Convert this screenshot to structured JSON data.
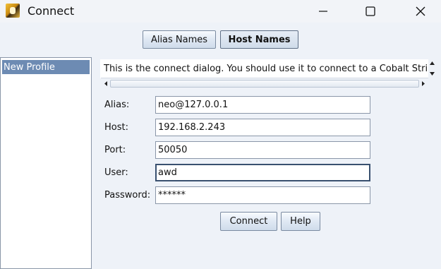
{
  "window": {
    "title": "Connect",
    "controls": [
      "minimize-icon",
      "maximize-icon",
      "close-icon"
    ]
  },
  "toolbar": {
    "alias_names_label": "Alias Names",
    "host_names_label": "Host Names"
  },
  "profiles": {
    "items": [
      {
        "label": "New Profile",
        "selected": true
      }
    ]
  },
  "description": {
    "text": "This is the connect dialog. You should use it to connect to a Cobalt Strik"
  },
  "form": {
    "alias_label": "Alias:",
    "alias_value": "neo@127.0.0.1",
    "host_label": "Host:",
    "host_value": "192.168.2.243",
    "port_label": "Port:",
    "port_value": "50050",
    "user_label": "User:",
    "user_value": "awd",
    "password_label": "Password:",
    "password_value": "******"
  },
  "actions": {
    "connect_label": "Connect",
    "help_label": "Help"
  }
}
